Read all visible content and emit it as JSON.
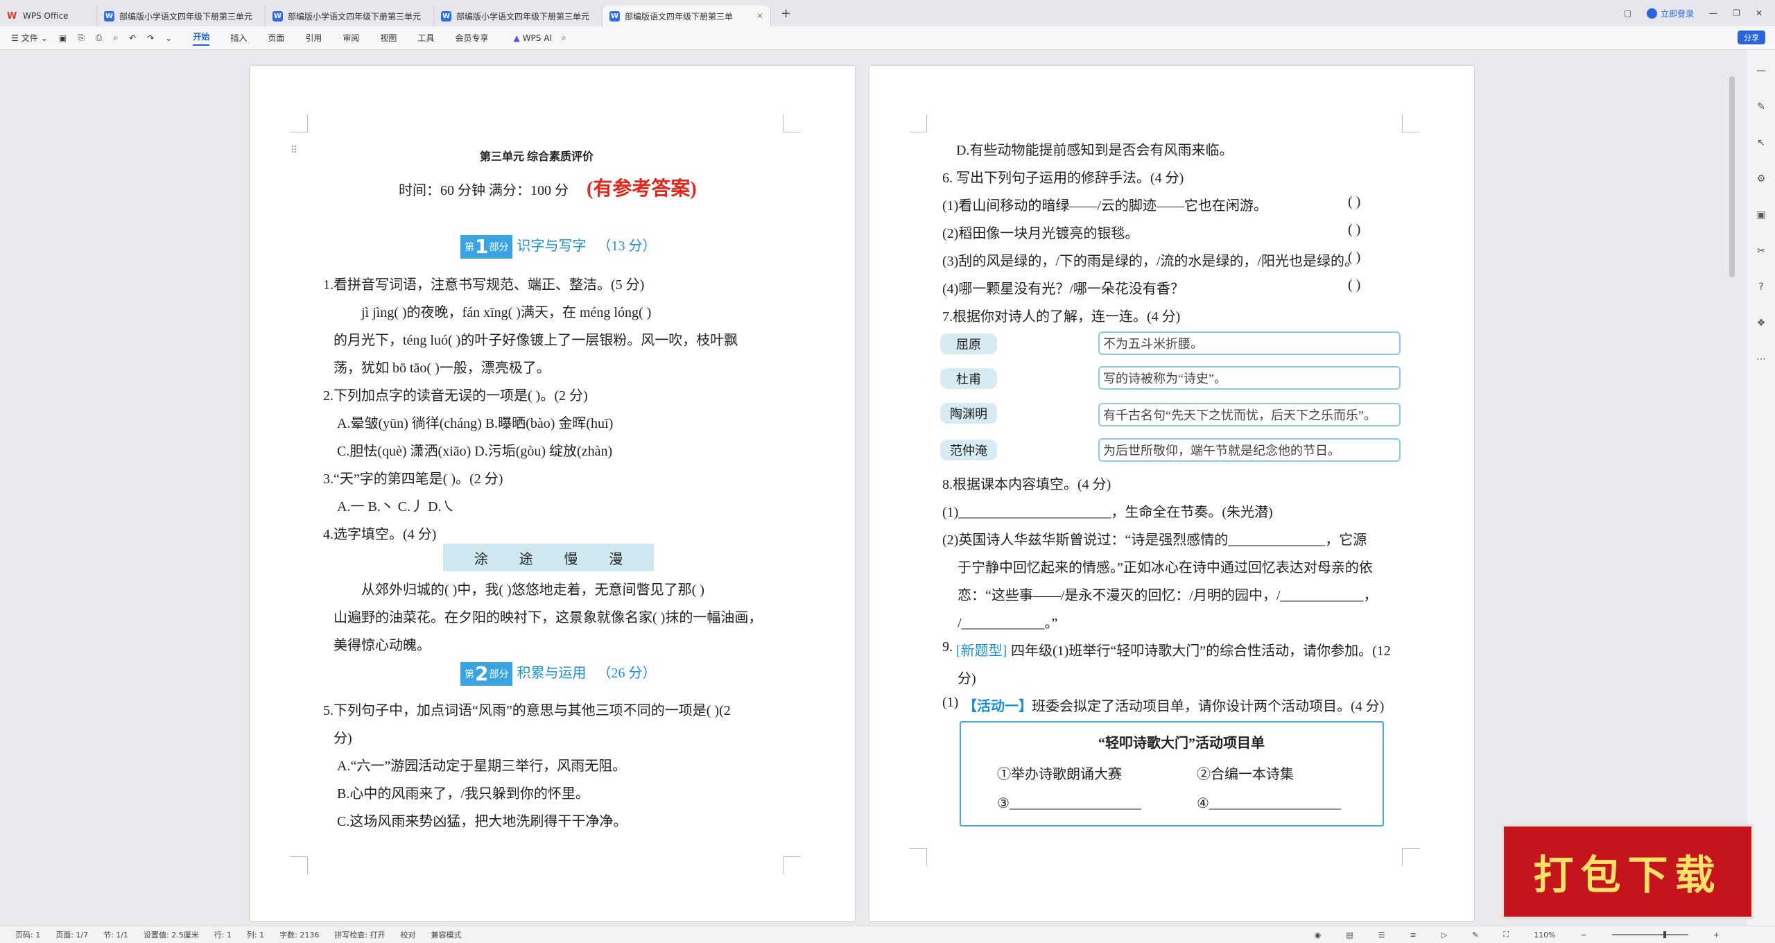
{
  "app": {
    "tabs": [
      {
        "label": "WPS Office"
      },
      {
        "label": "部编版小学语文四年级下册第三单元"
      },
      {
        "label": "部编版小学语文四年级下册第三单元"
      },
      {
        "label": "部编版小学语文四年级下册第三单元"
      },
      {
        "label": "部编版语文四年级下册第三单"
      }
    ],
    "login_label": "立即登录",
    "share_label": "分享"
  },
  "toolbar": {
    "file_label": "文件",
    "menu_tabs": [
      "开始",
      "插入",
      "页面",
      "引用",
      "审阅",
      "视图",
      "工具",
      "会员专享"
    ],
    "ai_label": "WPS AI"
  },
  "status": {
    "page_code": "页码: 1",
    "pages": "页面: 1/7",
    "section": "节: 1/1",
    "setting": "设置值: 2.5厘米",
    "row": "行: 1",
    "col": "列: 1",
    "word_count": "字数: 2136",
    "spellcheck": "拼写检查: 打开",
    "proof": "校对",
    "compat": "兼容模式",
    "zoom": "110%"
  },
  "banner": {
    "text": "打包下载"
  },
  "doc": {
    "unit_title": "第三单元  综合素质评价",
    "time_line": "时间：60 分钟    满分：100 分",
    "answer_note": "(有参考答案)",
    "part1": {
      "prefix": "第",
      "num": "1",
      "suffix": "部分",
      "title": "识字与写字",
      "score": "（13 分）"
    },
    "part2": {
      "prefix": "第",
      "num": "2",
      "suffix": "部分",
      "title": "积累与运用",
      "score": "（26 分）"
    },
    "q1": "1.看拼音写词语，注意书写规范、端正、整洁。(5 分)",
    "q1_l1": "jì jìng(          )的夜晚，fán xīng(          )满天，在 méng lóng(          )",
    "q1_l2": "的月光下，téng luó(          )的叶子好像镀上了一层银粉。风一吹，枝叶飘",
    "q1_l3": "荡，犹如 bō tāo(          )一般，漂亮极了。",
    "q2": "2.下列加点字的读音无误的一项是(      )。(2 分)",
    "q2_a": "A.晕皱(yūn)      徜徉(cháng)    B.曝晒(bào)      金晖(huī)",
    "q2_c": "C.胆怯(què)      潇洒(xiāo)     D.污垢(gòu)      绽放(zhàn)",
    "q3": "3.“天”字的第四笔是(      )。(2 分)",
    "q3_opts": "A.一                 B.丶                 C.丿                 D.㇏",
    "q4": "4.选字填空。(4 分)",
    "q4_words": [
      "涂",
      "途",
      "慢",
      "漫"
    ],
    "q4_l1": "从郊外归城的(      )中，我(      )悠悠地走着，无意间瞥见了那(      )",
    "q4_l2": "山遍野的油菜花。在夕阳的映衬下，这景象就像名家(      )抹的一幅油画，",
    "q4_l3": "美得惊心动魄。",
    "q5": "5.下列句子中，加点词语“风雨”的意思与其他三项不同的一项是(      )(2",
    "q5_cont": "分)",
    "q5_a": "A.“六一”游园活动定于星期三举行，风雨无阻。",
    "q5_b": "B.心中的风雨来了，/我只躲到你的怀里。",
    "q5_c": "C.这场风雨来势凶猛，把大地洗刷得干干净净。",
    "q5_d": "D.有些动物能提前感知到是否会有风雨来临。",
    "q6": "6. 写出下列句子运用的修辞手法。(4 分)",
    "q6_items": [
      "(1)看山间移动的暗绿——/云的脚迹——它也在闲游。",
      "(2)稻田像一块月光镀亮的银毯。",
      "(3)刮的风是绿的，/下的雨是绿的，/流的水是绿的，/阳光也是绿的。",
      "(4)哪一颗星没有光？/哪一朵花没有香？"
    ],
    "q6_paren": "(          )",
    "q7": "7.根据你对诗人的了解，连一连。(4 分)",
    "poets": [
      "屈原",
      "杜甫",
      "陶渊明",
      "范仲淹"
    ],
    "poet_desc": [
      "不为五斗米折腰。",
      "写的诗被称为“诗史”。",
      "有千古名句“先天下之忧而忧，后天下之乐而乐”。",
      "为后世所敬仰，端午节就是纪念他的节日。"
    ],
    "q8": "8.根据课本内容填空。(4 分)",
    "q8_1": "(1)______________________，生命全在节奏。(朱光潜)",
    "q8_2a": "(2)英国诗人华兹华斯曾说过：“诗是强烈感情的______________，它源",
    "q8_2b": "于宁静中回忆起来的情感。”正如冰心在诗中通过回忆表达对母亲的依",
    "q8_2c": "恋：“这些事——/是永不漫灭的回忆：/月明的园中，/____________，",
    "q8_2d": "/____________。”",
    "q9_num": "9.",
    "q9_tag": "[新题型]",
    "q9_text": "四年级(1)班举行“轻叩诗歌大门”的综合性活动，请你参加。(12",
    "q9_cont": "分)",
    "q9_1_pre": "(1)",
    "q9_1_tag": "【活动一】",
    "q9_1_text": "班委会拟定了活动项目单，请你设计两个活动项目。(4 分)",
    "act_title": "“轻叩诗歌大门”活动项目单",
    "act_1": "①举办诗歌朗诵大赛",
    "act_2": "②合编一本诗集",
    "act_3": "③___________________",
    "act_4": "④___________________"
  }
}
